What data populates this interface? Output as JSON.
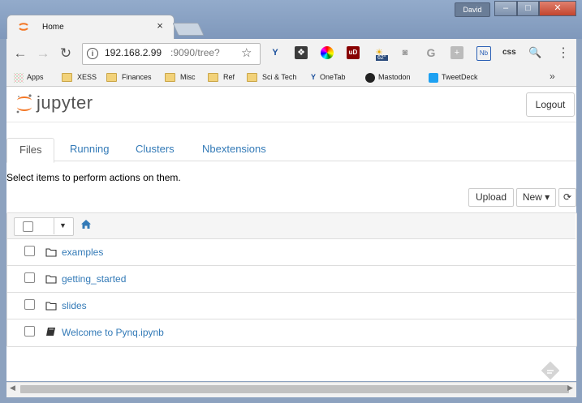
{
  "browser": {
    "tab_title": "Home",
    "tab_close": "×",
    "user_name": "David",
    "window_controls": {
      "minimize": "–",
      "maximize": "□",
      "close": "✕"
    },
    "url_host": "192.168.2.99",
    "url_path": ":9090/tree?",
    "extension_weather": "62°",
    "extension_css": "css",
    "bookmarks": [
      "Apps",
      "XESS",
      "Finances",
      "Misc",
      "Ref",
      "Sci & Tech",
      "OneTab",
      "Mastodon",
      "TweetDeck"
    ],
    "bookmarks_more": "»"
  },
  "jupyter": {
    "logo_text": "jupyter",
    "logout_label": "Logout",
    "tabs": [
      "Files",
      "Running",
      "Clusters",
      "Nbextensions"
    ],
    "select_message": "Select items to perform actions on them.",
    "upload_label": "Upload",
    "new_label": "New ▾",
    "files": [
      {
        "name": "examples",
        "type": "folder"
      },
      {
        "name": "getting_started",
        "type": "folder"
      },
      {
        "name": "slides",
        "type": "folder"
      },
      {
        "name": "Welcome to Pynq.ipynb",
        "type": "notebook"
      }
    ]
  },
  "colors": {
    "link": "#337ab7",
    "jupyter_orange": "#f37726",
    "chrome_frame": "#8da2bf"
  }
}
